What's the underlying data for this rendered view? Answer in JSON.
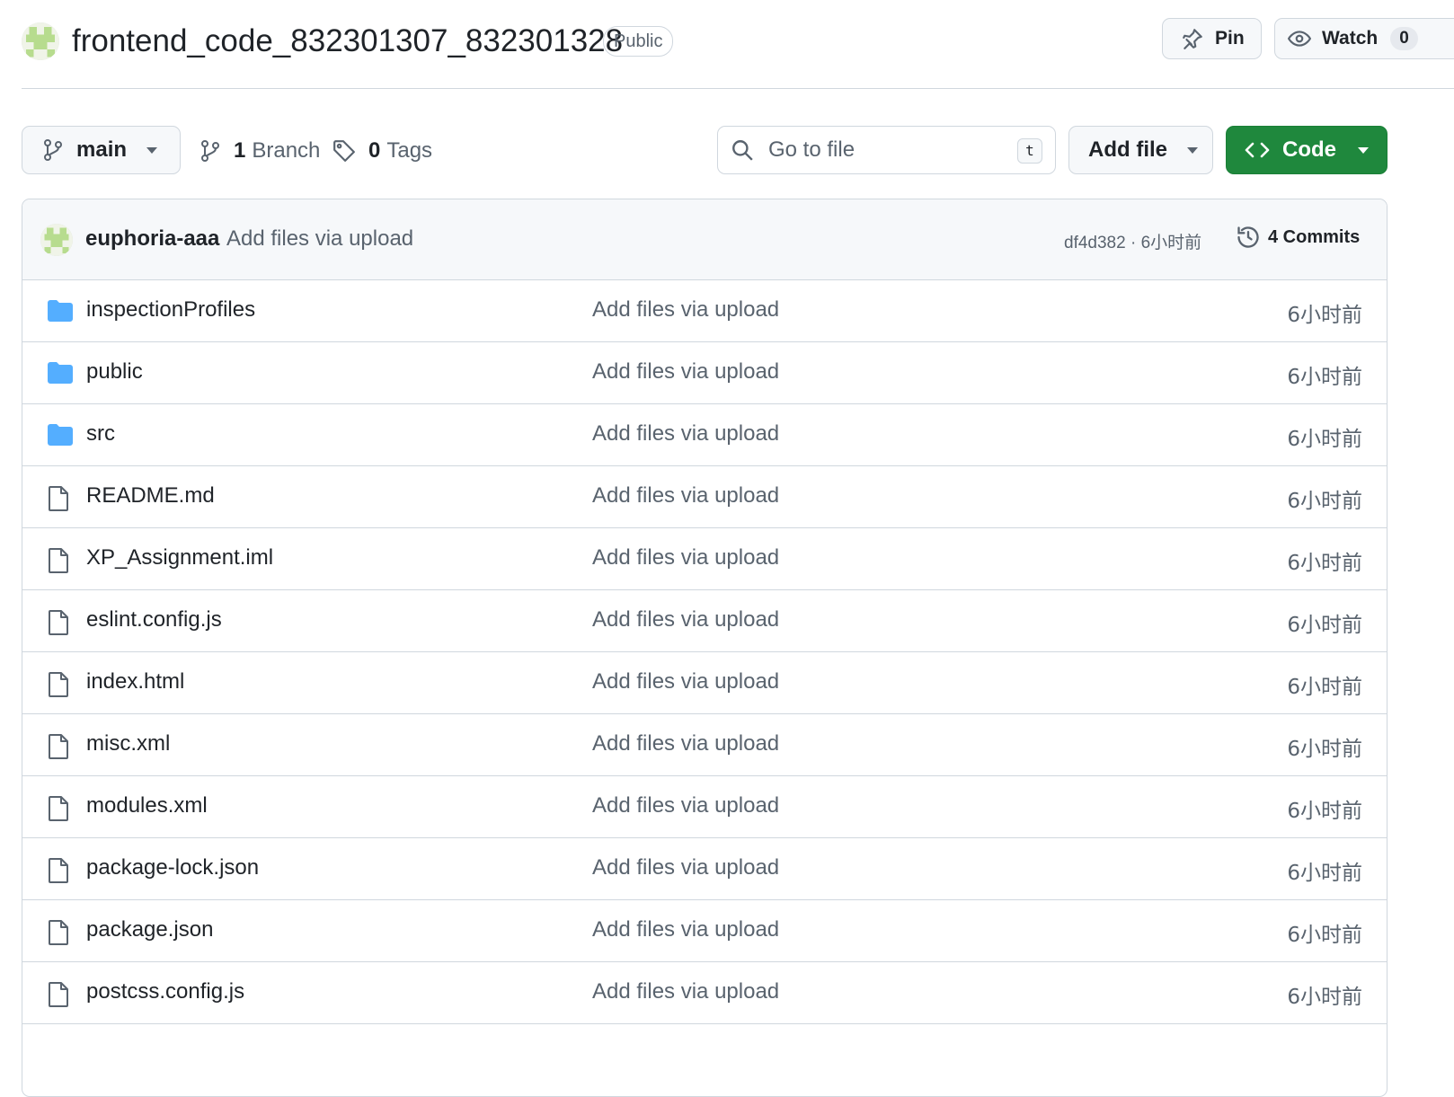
{
  "repo": {
    "name": "frontend_code_832301307_832301328",
    "visibility": "Public",
    "pin_label": "Pin",
    "watch_label": "Watch",
    "watch_count": "0"
  },
  "toolbar": {
    "branch": "main",
    "branches_count": "1",
    "branches_label": "Branch",
    "tags_count": "0",
    "tags_label": "Tags",
    "search_placeholder": "Go to file",
    "search_shortcut": "t",
    "add_file_label": "Add file",
    "code_label": "Code"
  },
  "latest_commit": {
    "author": "euphoria-aaa",
    "message": "Add files via upload",
    "hash_time": "df4d382 · 6小时前",
    "commits_label": "4 Commits"
  },
  "colors": {
    "accent_green": "#1f883d",
    "folder_blue": "#54aeff",
    "muted_text": "#59636e",
    "border": "#d0d7de"
  },
  "files": [
    {
      "name": "inspectionProfiles",
      "type": "folder",
      "icon": "folder-icon",
      "message": "Add files via upload",
      "time": "6小时前"
    },
    {
      "name": "public",
      "type": "folder",
      "icon": "folder-icon",
      "message": "Add files via upload",
      "time": "6小时前"
    },
    {
      "name": "src",
      "type": "folder",
      "icon": "folder-icon",
      "message": "Add files via upload",
      "time": "6小时前"
    },
    {
      "name": "README.md",
      "type": "file",
      "icon": "file-icon",
      "message": "Add files via upload",
      "time": "6小时前"
    },
    {
      "name": "XP_Assignment.iml",
      "type": "file",
      "icon": "file-icon",
      "message": "Add files via upload",
      "time": "6小时前"
    },
    {
      "name": "eslint.config.js",
      "type": "file",
      "icon": "file-icon",
      "message": "Add files via upload",
      "time": "6小时前"
    },
    {
      "name": "index.html",
      "type": "file",
      "icon": "file-icon",
      "message": "Add files via upload",
      "time": "6小时前"
    },
    {
      "name": "misc.xml",
      "type": "file",
      "icon": "file-icon",
      "message": "Add files via upload",
      "time": "6小时前"
    },
    {
      "name": "modules.xml",
      "type": "file",
      "icon": "file-icon",
      "message": "Add files via upload",
      "time": "6小时前"
    },
    {
      "name": "package-lock.json",
      "type": "file",
      "icon": "file-icon",
      "message": "Add files via upload",
      "time": "6小时前"
    },
    {
      "name": "package.json",
      "type": "file",
      "icon": "file-icon",
      "message": "Add files via upload",
      "time": "6小时前"
    },
    {
      "name": "postcss.config.js",
      "type": "file",
      "icon": "file-icon",
      "message": "Add files via upload",
      "time": "6小时前"
    }
  ]
}
